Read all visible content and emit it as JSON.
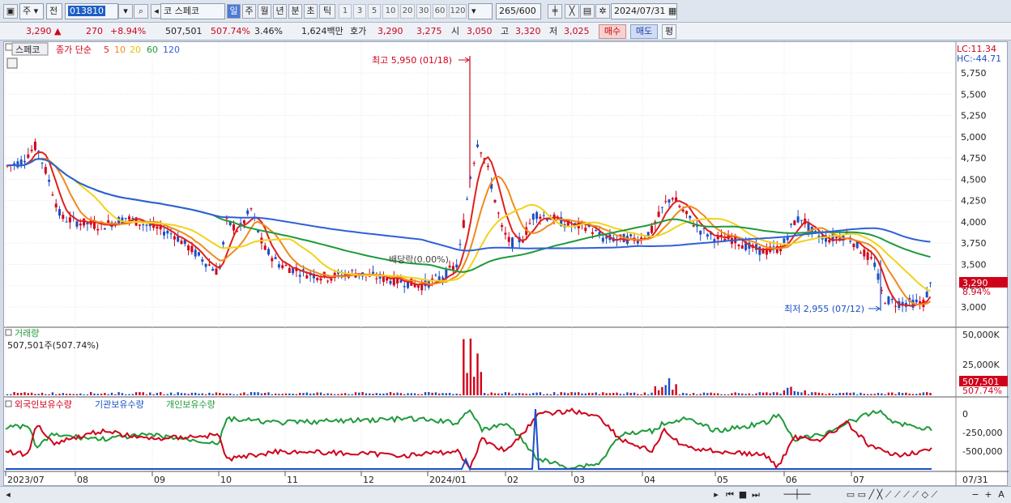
{
  "toolbar": {
    "chart_type": "주",
    "prev_label": "전",
    "code": "013810",
    "market": "코",
    "name": "스페코",
    "periods": [
      "일",
      "주",
      "월",
      "년",
      "분",
      "초",
      "틱"
    ],
    "active_period": "일",
    "intervals": [
      "1",
      "3",
      "5",
      "10",
      "20",
      "30",
      "60",
      "120"
    ],
    "count": "265",
    "count_total": "/600",
    "date": "2024/07/31"
  },
  "info": {
    "price": "3,290",
    "arrow": "▲",
    "change": "270",
    "change_pct": "+8.94%",
    "volume": "507,501",
    "volume_ratio": "507.74%",
    "turnover": "3.46%",
    "amount": "1,624백만",
    "quote_label": "호가",
    "ask": "3,290",
    "bid": "3,275",
    "open_label": "시",
    "open": "3,050",
    "high_label": "고",
    "high": "3,320",
    "low_label": "저",
    "low": "3,025",
    "buy": "매수",
    "sell": "매도",
    "eval": "평"
  },
  "price_panel": {
    "name_tag": "스페코",
    "legend_prefix": "종가 단순",
    "ma_labels": [
      {
        "label": "5",
        "color": "#e0201c"
      },
      {
        "label": "10",
        "color": "#f08a1c"
      },
      {
        "label": "20",
        "color": "#f2d21c"
      },
      {
        "label": "60",
        "color": "#1f9a3a"
      },
      {
        "label": "120",
        "color": "#2f5fd8"
      }
    ],
    "lc": "LC:11.34",
    "hc": "HC:-44.71",
    "y_ticks": [
      "5,750",
      "5,500",
      "5,250",
      "5,000",
      "4,750",
      "4,500",
      "4,250",
      "4,000",
      "3,750",
      "3,500",
      "3,250",
      "3,000"
    ],
    "current_price": "3,290",
    "current_pct": "8.94%",
    "high_annot": "최고 5,950 (01/18)",
    "low_annot": "최저 2,955 (07/12)",
    "dividend_annot": "배당락(0.00%)"
  },
  "volume_panel": {
    "title": "거래량",
    "value_label": "507,501주(507.74%)",
    "y_ticks": [
      "50,000K",
      "25,000K"
    ],
    "current": "507,501",
    "current_pct": "507.74%"
  },
  "holding_panel": {
    "labels": [
      "외국인보유수량",
      "기관보유수량",
      "개인보유수량"
    ],
    "colors": [
      "#d0021b",
      "#1c4fc7",
      "#1f9a3a"
    ],
    "y_ticks": [
      "0",
      "-250,000",
      "-500,000"
    ]
  },
  "x_axis": {
    "labels": [
      "2023/07",
      "08",
      "09",
      "10",
      "11",
      "12",
      "2024/01",
      "02",
      "03",
      "04",
      "05",
      "06",
      "07"
    ],
    "right_label": "07/31"
  },
  "colors": {
    "up": "#d0021b",
    "down": "#1c4fc7",
    "ma5": "#e0201c",
    "ma10": "#f08a1c",
    "ma20": "#f2d21c",
    "ma60": "#1f9a3a",
    "ma120": "#2f5fd8"
  }
}
